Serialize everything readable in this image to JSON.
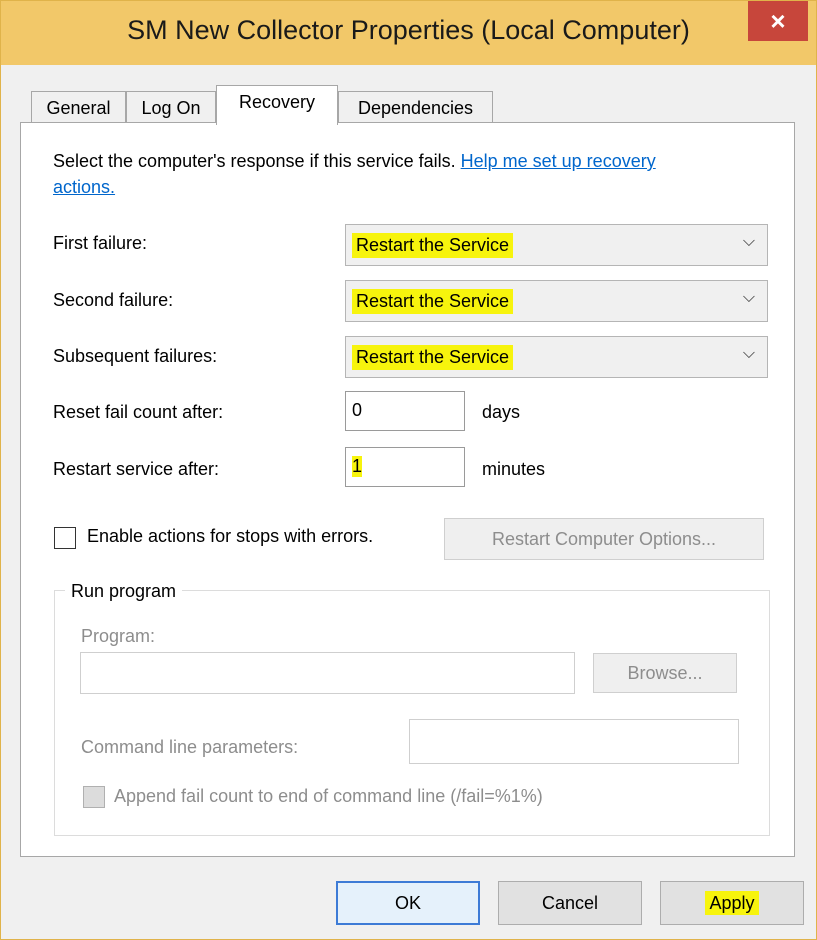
{
  "window": {
    "title": "SM New Collector Properties (Local Computer)",
    "close_label": "×"
  },
  "tabs": [
    {
      "label": "General"
    },
    {
      "label": "Log On"
    },
    {
      "label": "Recovery"
    },
    {
      "label": "Dependencies"
    }
  ],
  "recovery": {
    "intro_text": "Select the computer's response if this service fails. ",
    "help_link_part1": "Help me set up recovery",
    "help_link_part2": "actions.",
    "first_failure_label": "First failure:",
    "first_failure_value": "Restart the Service",
    "second_failure_label": "Second failure:",
    "second_failure_value": "Restart the Service",
    "subsequent_failures_label": "Subsequent failures:",
    "subsequent_failures_value": "Restart the Service",
    "reset_label": "Reset fail count after:",
    "reset_value": "0",
    "reset_unit": "days",
    "restart_label": "Restart service after:",
    "restart_value": "1",
    "restart_unit": "minutes",
    "enable_actions_label": "Enable actions for stops with errors.",
    "enable_actions_checked": false,
    "restart_computer_options_label": "Restart Computer Options..."
  },
  "run_program": {
    "group_label": "Run program",
    "program_label": "Program:",
    "program_value": "",
    "browse_label": "Browse...",
    "cmd_params_label": "Command line parameters:",
    "cmd_params_value": "",
    "append_label": "Append fail count to end of command line (/fail=%1%)"
  },
  "footer": {
    "ok_label": "OK",
    "cancel_label": "Cancel",
    "apply_label": "Apply"
  },
  "colors": {
    "titlebar": "#f2c869",
    "close_button": "#c7463b",
    "highlight": "#f7f40d",
    "link": "#0066cc"
  }
}
